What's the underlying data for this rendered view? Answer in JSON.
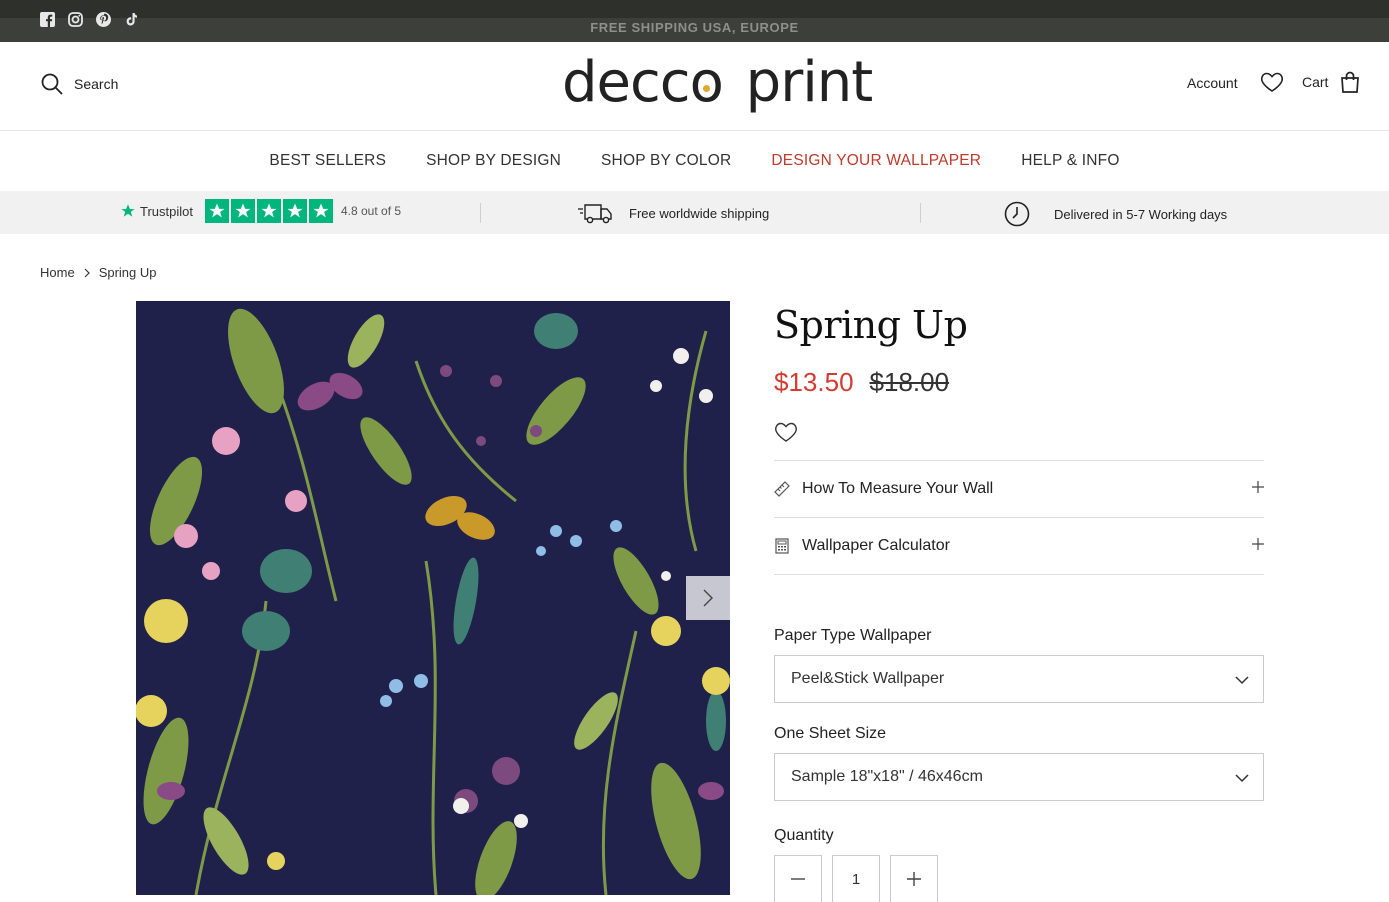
{
  "announcement": {
    "text": "FREE SHIPPING USA, EUROPE",
    "social": [
      "facebook-icon",
      "instagram-icon",
      "pinterest-icon",
      "tiktok-icon"
    ]
  },
  "header": {
    "search_label": "Search",
    "logo_text_1": "decco",
    "logo_text_2": "print",
    "account_label": "Account",
    "cart_label": "Cart"
  },
  "nav": {
    "items": [
      "BEST SELLERS",
      "SHOP BY DESIGN",
      "SHOP BY COLOR",
      "DESIGN YOUR WALLPAPER",
      "HELP & INFO"
    ],
    "accent_color": "#c0392b"
  },
  "trust": {
    "trustpilot_label": "Trustpilot",
    "rating_text": "4.8 out of 5",
    "shipping_text": "Free worldwide shipping",
    "delivery_text": "Delivered in 5-7 Working days"
  },
  "breadcrumb": {
    "home": "Home",
    "current": "Spring Up"
  },
  "product": {
    "title": "Spring Up",
    "price_sale": "$13.50",
    "price_regular": "$18.00",
    "sale_color": "#d23b32",
    "accordions": [
      "How To Measure Your Wall",
      "Wallpaper Calculator"
    ],
    "paper_type_label": "Paper Type Wallpaper",
    "paper_type_value": "Peel&Stick Wallpaper",
    "size_label": "One Sheet Size",
    "size_value": "Sample 18\"x18\" / 46x46cm",
    "quantity_label": "Quantity",
    "quantity_value": "1"
  }
}
